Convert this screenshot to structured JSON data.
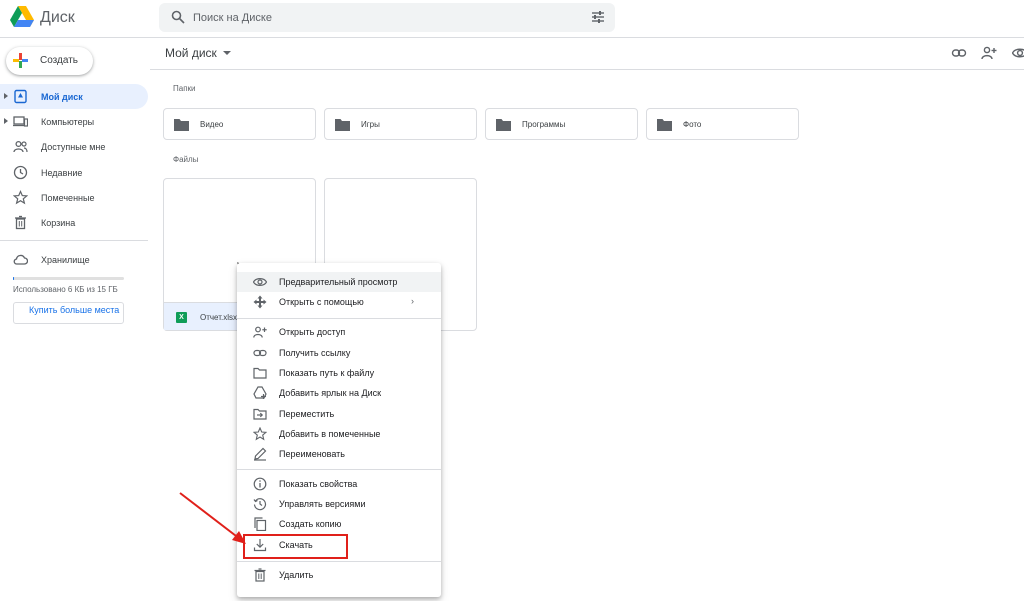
{
  "header": {
    "app_title": "Диск",
    "search_placeholder": "Поиск на Диске",
    "icons": {
      "logo": "drive-logo",
      "search": "search-icon",
      "options": "tune-icon"
    }
  },
  "sidebar": {
    "create_label": "Создать",
    "items": [
      {
        "label": "Мой диск",
        "icon": "my-drive-icon",
        "active": true,
        "expandable": true
      },
      {
        "label": "Компьютеры",
        "icon": "computers-icon",
        "active": false,
        "expandable": true
      },
      {
        "label": "Доступные мне",
        "icon": "shared-icon",
        "active": false,
        "expandable": false
      },
      {
        "label": "Недавние",
        "icon": "clock-icon",
        "active": false,
        "expandable": false
      },
      {
        "label": "Помеченные",
        "icon": "star-icon",
        "active": false,
        "expandable": false
      },
      {
        "label": "Корзина",
        "icon": "trash-icon",
        "active": false,
        "expandable": false
      }
    ],
    "storage": {
      "label": "Хранилище",
      "used_text": "Использовано 6 КБ из 15 ГБ",
      "used_fraction": 4e-07,
      "buy_label": "Купить больше места"
    }
  },
  "main": {
    "breadcrumb": "Мой диск",
    "folders_label": "Папки",
    "files_label": "Файлы",
    "folders": [
      "Видео",
      "Игры",
      "Программы",
      "Фото"
    ],
    "files": [
      {
        "name": "Отчет.xlsx",
        "type": "xlsx"
      }
    ]
  },
  "context_menu": {
    "items": [
      {
        "label": "Предварительный просмотр",
        "icon": "eye-icon"
      },
      {
        "label": "Открыть с помощью",
        "icon": "open-with-icon",
        "submenu_arrow": "›"
      },
      {
        "label": "Открыть доступ",
        "icon": "person-add-icon"
      },
      {
        "label": "Получить ссылку",
        "icon": "link-icon"
      },
      {
        "label": "Показать путь к файлу",
        "icon": "folder-outline-icon"
      },
      {
        "label": "Добавить ярлык на Диск",
        "icon": "add-shortcut-icon"
      },
      {
        "label": "Переместить",
        "icon": "move-icon"
      },
      {
        "label": "Добавить в помеченные",
        "icon": "star-icon"
      },
      {
        "label": "Переименовать",
        "icon": "edit-icon"
      },
      {
        "label": "Показать свойства",
        "icon": "info-icon"
      },
      {
        "label": "Управлять версиями",
        "icon": "history-icon"
      },
      {
        "label": "Создать копию",
        "icon": "copy-icon"
      },
      {
        "label": "Скачать",
        "icon": "download-icon",
        "highlighted": true
      },
      {
        "label": "Удалить",
        "icon": "trash-icon"
      }
    ]
  },
  "colors": {
    "accent": "#1a73e8",
    "active_bg": "#e8f0fe",
    "annotation": "#e0201a"
  }
}
